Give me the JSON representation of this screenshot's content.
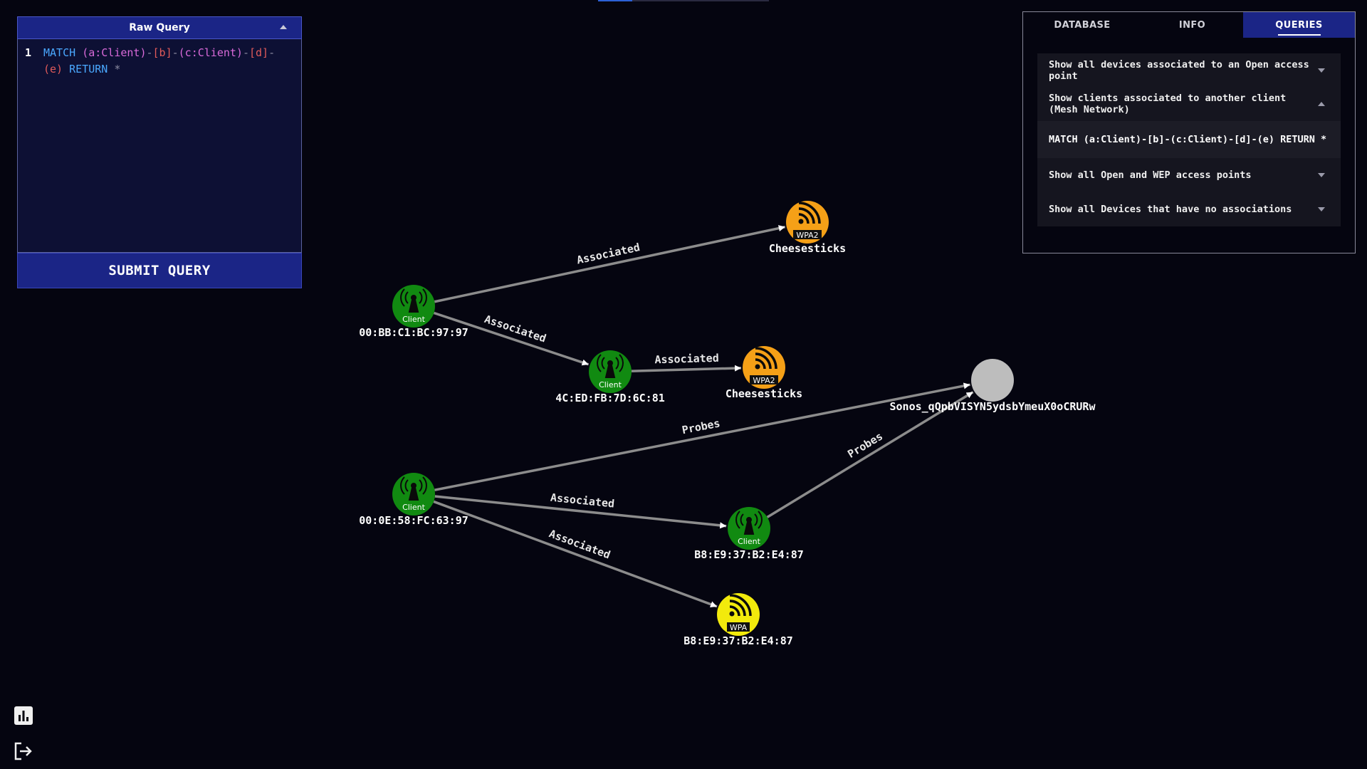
{
  "query_panel": {
    "title": "Raw Query",
    "line_number": "1",
    "query_tokens": [
      {
        "t": "MATCH ",
        "c": "kw"
      },
      {
        "t": "(a:Client)",
        "c": "var"
      },
      {
        "t": "-",
        "c": "pun"
      },
      {
        "t": "[b]",
        "c": "rel"
      },
      {
        "t": "-",
        "c": "pun"
      },
      {
        "t": "(c:Client)",
        "c": "var"
      },
      {
        "t": "-",
        "c": "pun"
      },
      {
        "t": "[d]",
        "c": "rel"
      },
      {
        "t": "- ",
        "c": "pun"
      },
      {
        "t": "(e)",
        "c": "rel"
      },
      {
        "t": " RETURN ",
        "c": "kw"
      },
      {
        "t": "*",
        "c": "pun"
      }
    ],
    "submit_label": "SUBMIT QUERY"
  },
  "side_panel": {
    "tabs": [
      {
        "label": "DATABASE",
        "active": false
      },
      {
        "label": "INFO",
        "active": false
      },
      {
        "label": "QUERIES",
        "active": true
      }
    ],
    "queries": [
      {
        "label": "Show all devices associated to an Open access point",
        "expanded": false
      },
      {
        "label": "Show clients associated to another client (Mesh Network)",
        "expanded": true,
        "detail": "MATCH (a:Client)-[b]-(c:Client)-[d]-(e) RETURN *"
      },
      {
        "label": "Show all Open and WEP access points",
        "expanded": false
      },
      {
        "label": "Show all Devices that have no associations",
        "expanded": false
      }
    ]
  },
  "graph": {
    "colors": {
      "client": "#118a11",
      "wpa2": "#f5a017",
      "wpa": "#f2ea0c",
      "unknown": "#bdbdbd",
      "edge": "#8c8c8c"
    },
    "nodes": [
      {
        "id": "n1",
        "type": "client",
        "badge": "Client",
        "label": "00:BB:C1:BC:97:97"
      },
      {
        "id": "n2",
        "type": "wpa2",
        "badge": "WPA2",
        "label": "Cheesesticks"
      },
      {
        "id": "n3",
        "type": "client",
        "badge": "Client",
        "label": "4C:ED:FB:7D:6C:81"
      },
      {
        "id": "n4",
        "type": "wpa2",
        "badge": "WPA2",
        "label": "Cheesesticks"
      },
      {
        "id": "n5",
        "type": "unknown",
        "badge": "",
        "label": "Sonos_qQpbVISYN5ydsbYmeuX0oCRURw"
      },
      {
        "id": "n6",
        "type": "client",
        "badge": "Client",
        "label": "00:0E:58:FC:63:97"
      },
      {
        "id": "n7",
        "type": "client",
        "badge": "Client",
        "label": "B8:E9:37:B2:E4:87"
      },
      {
        "id": "n8",
        "type": "wpa",
        "badge": "WPA",
        "label": "B8:E9:37:B2:E4:87"
      }
    ],
    "edges": [
      {
        "from": "n1",
        "to": "n2",
        "label": "Associated"
      },
      {
        "from": "n1",
        "to": "n3",
        "label": "Associated"
      },
      {
        "from": "n3",
        "to": "n4",
        "label": "Associated"
      },
      {
        "from": "n6",
        "to": "n5",
        "label": "Probes"
      },
      {
        "from": "n7",
        "to": "n5",
        "label": "Probes"
      },
      {
        "from": "n6",
        "to": "n7",
        "label": "Associated"
      },
      {
        "from": "n6",
        "to": "n8",
        "label": "Associated"
      }
    ]
  },
  "bottom_icons": [
    "chart-icon",
    "logout-icon"
  ]
}
